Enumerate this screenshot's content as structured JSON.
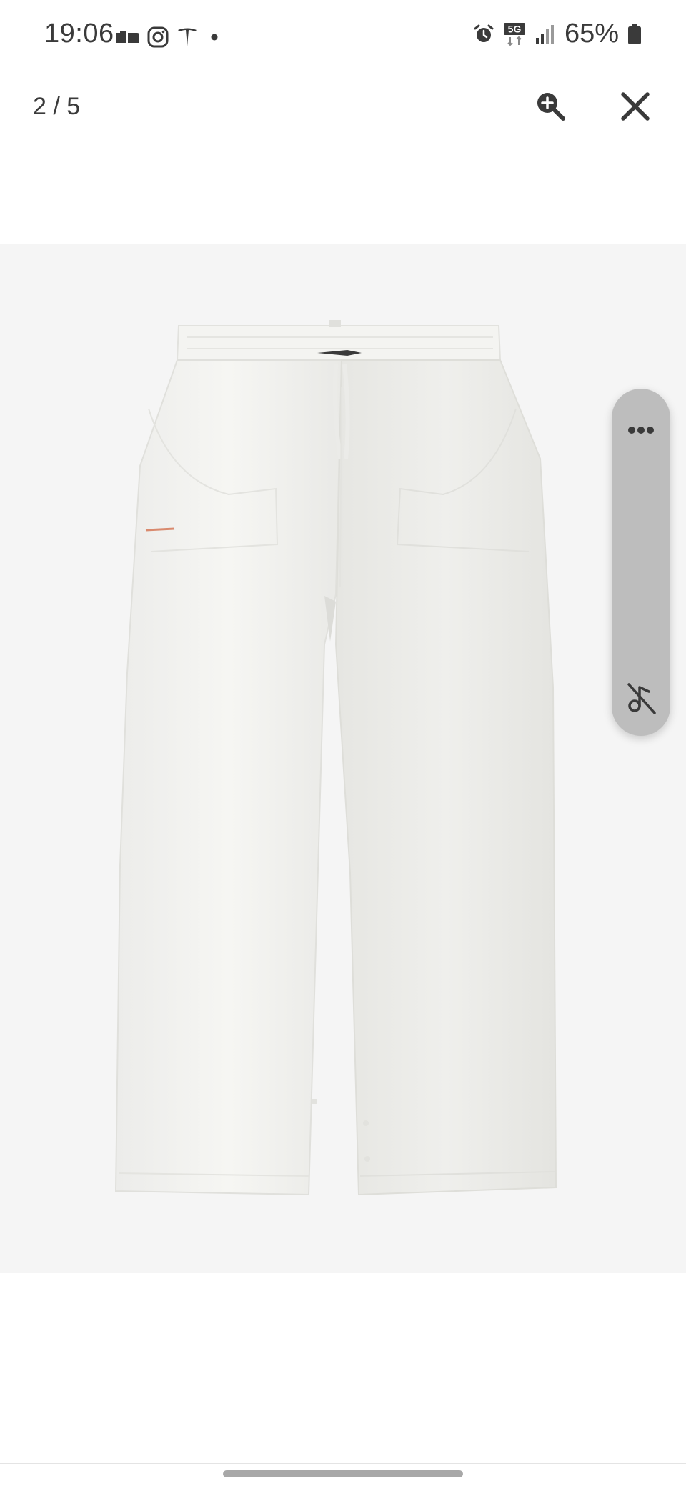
{
  "status_bar": {
    "time": "19:06",
    "left_icons": [
      "messages-icon",
      "instagram-icon",
      "tesla-icon",
      "dot-icon"
    ],
    "right_icons": [
      "alarm-icon",
      "5g-icon",
      "signal-icon",
      "battery-icon"
    ],
    "network_label": "5G",
    "battery_percent": "65%"
  },
  "viewer": {
    "counter": "2 / 5",
    "zoom_icon": "zoom-in-icon",
    "close_icon": "close-icon"
  },
  "image": {
    "subject": "white linen trousers",
    "background": "#f5f5f5"
  },
  "side_panel": {
    "more_icon": "more-horizontal-icon",
    "mute_icon": "music-off-icon",
    "color": "#bdbdbd"
  },
  "colors": {
    "text": "#3a3a3a",
    "page_bg": "#ffffff"
  }
}
